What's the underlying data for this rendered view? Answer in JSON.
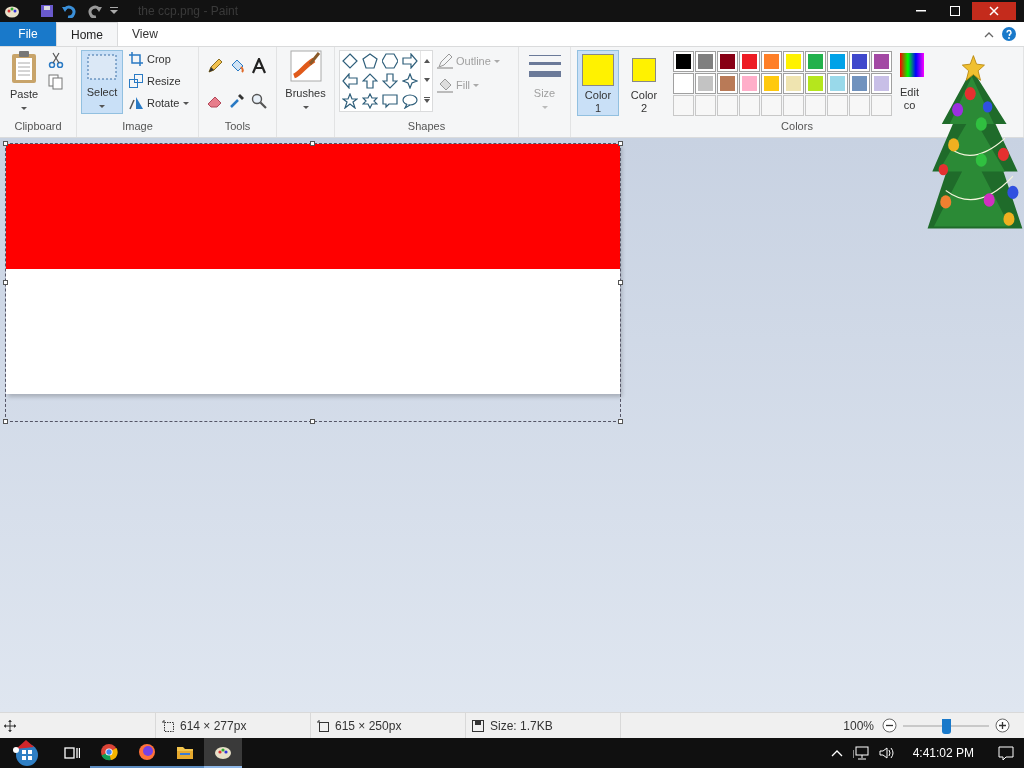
{
  "title_bar": {
    "title": "the ccp.png - Paint"
  },
  "tabs": [
    {
      "label": "File",
      "kind": "file",
      "selected": false
    },
    {
      "label": "Home",
      "kind": "tab",
      "selected": true
    },
    {
      "label": "View",
      "kind": "tab",
      "selected": false
    }
  ],
  "clipboard": {
    "paste": "Paste",
    "group": "Clipboard"
  },
  "image": {
    "select": {
      "label": "Select",
      "selected": true
    },
    "crop": "Crop",
    "resize": "Resize",
    "rotate": "Rotate",
    "group": "Image"
  },
  "tools": {
    "group": "Tools"
  },
  "brushes": {
    "label": "Brushes"
  },
  "shapes": {
    "outline": {
      "label": "Outline",
      "disabled": true
    },
    "fill": {
      "label": "Fill",
      "disabled": true
    },
    "group": "Shapes"
  },
  "size": {
    "label": "Size",
    "disabled": true
  },
  "colors": {
    "group": "Colors",
    "slots": [
      {
        "lines": [
          "Color",
          "1"
        ],
        "color": "#fff200",
        "selected": true
      },
      {
        "lines": [
          "Color",
          "2"
        ],
        "color": "#fff200",
        "selected": false
      }
    ],
    "palette": [
      {
        "color": "#000000"
      },
      {
        "color": "#7f7f7f"
      },
      {
        "color": "#880015"
      },
      {
        "color": "#ed1c24"
      },
      {
        "color": "#ff7f27"
      },
      {
        "color": "#fff200"
      },
      {
        "color": "#22b14c"
      },
      {
        "color": "#00a2e8"
      },
      {
        "color": "#3f48cc"
      },
      {
        "color": "#a349a4"
      },
      {
        "color": "#ffffff"
      },
      {
        "color": "#c3c3c3"
      },
      {
        "color": "#b97a57"
      },
      {
        "color": "#ffaec9"
      },
      {
        "color": "#ffc90e"
      },
      {
        "color": "#efe4b0"
      },
      {
        "color": "#b5e61d"
      },
      {
        "color": "#99d9ea"
      },
      {
        "color": "#7092be"
      },
      {
        "color": "#c8bfe7"
      }
    ],
    "edit_colors": [
      "Edit",
      "co"
    ]
  },
  "canvas": {
    "bands": [
      {
        "color": "#ff0000"
      },
      {
        "color": "#ffffff"
      }
    ]
  },
  "status_bar": {
    "selection_size": "614 × 277px",
    "image_size": "615 × 250px",
    "file_size": "Size: 1.7KB",
    "zoom": "100%",
    "zoom_slider": {
      "level": 0.5
    }
  },
  "taskbar": {
    "clock": "4:41:02 PM"
  }
}
